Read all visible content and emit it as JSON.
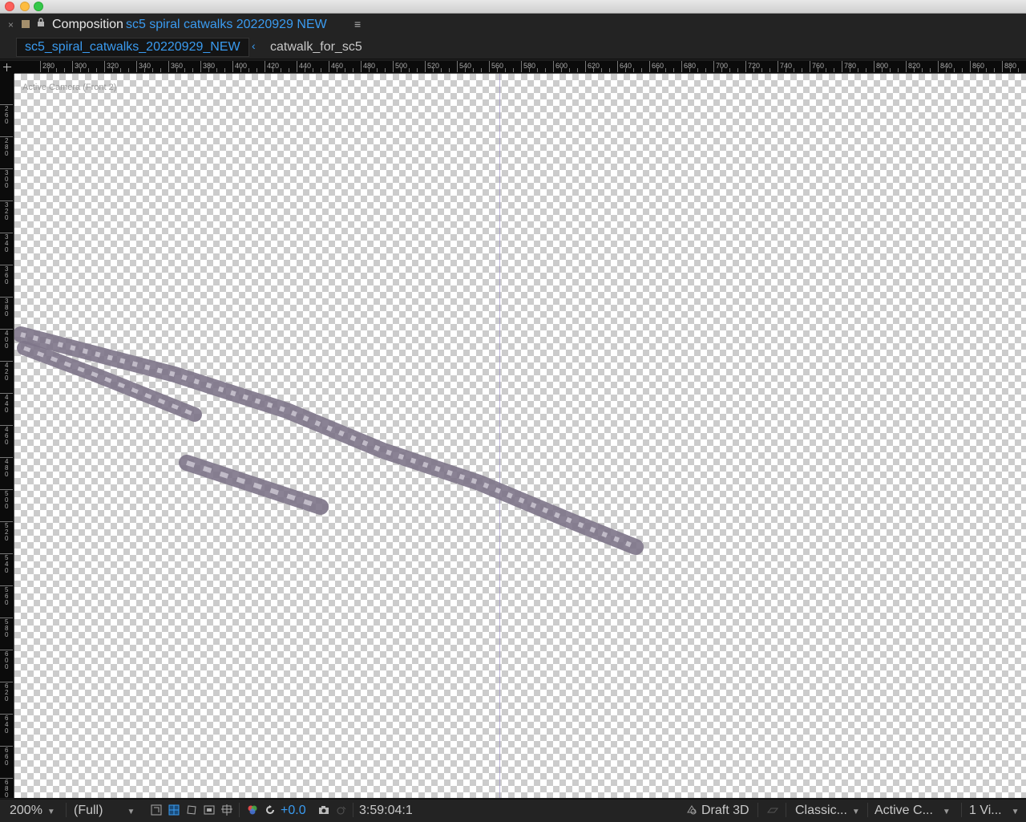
{
  "panel": {
    "title_prefix": "Composition",
    "comp_name": "sc5  spiral  catwalks  20220929  NEW",
    "menu_glyph": "≡",
    "close_glyph": "×",
    "lock_glyph": "🔒"
  },
  "breadcrumbs": {
    "active": "sc5_spiral_catwalks_20220929_NEW",
    "arrow": "‹",
    "second": "catwalk_for_sc5"
  },
  "rulers": {
    "top_labels": [
      "280",
      "300",
      "320",
      "340",
      "360",
      "380",
      "400",
      "420",
      "440",
      "460",
      "480",
      "500",
      "520",
      "540",
      "560",
      "580",
      "600",
      "620",
      "640",
      "660",
      "680",
      "700",
      "720",
      "740",
      "760",
      "780",
      "800",
      "820",
      "840",
      "860",
      "880"
    ],
    "left_labels": [
      "260",
      "280",
      "300",
      "320",
      "340",
      "360",
      "380",
      "400",
      "420",
      "440",
      "460",
      "480",
      "500",
      "520",
      "540",
      "560",
      "580",
      "600",
      "620",
      "640",
      "660",
      "680"
    ]
  },
  "viewer": {
    "camera_label": "Active Camera (Front 2)"
  },
  "footer": {
    "zoom": "200%",
    "resolution": "(Full)",
    "exposure": "+0.0",
    "timecode": "3:59:04:1",
    "renderer": "Draft 3D",
    "view_layout_mode": "Classic...",
    "camera_view": "Active C...",
    "views": "1 Vi..."
  },
  "colors": {
    "accent_blue": "#3a9bf0",
    "catwalk": "#7d7488"
  },
  "icons": [
    "close-icon",
    "lock-icon",
    "panel-menu-icon",
    "region-of-interest-icon",
    "transparency-grid-icon",
    "mask-visibility-icon",
    "safe-area-icon",
    "grid-icon",
    "color-channels-icon",
    "reset-exposure-icon",
    "snapshot-icon",
    "show-snapshot-icon",
    "draft-3d-icon"
  ]
}
